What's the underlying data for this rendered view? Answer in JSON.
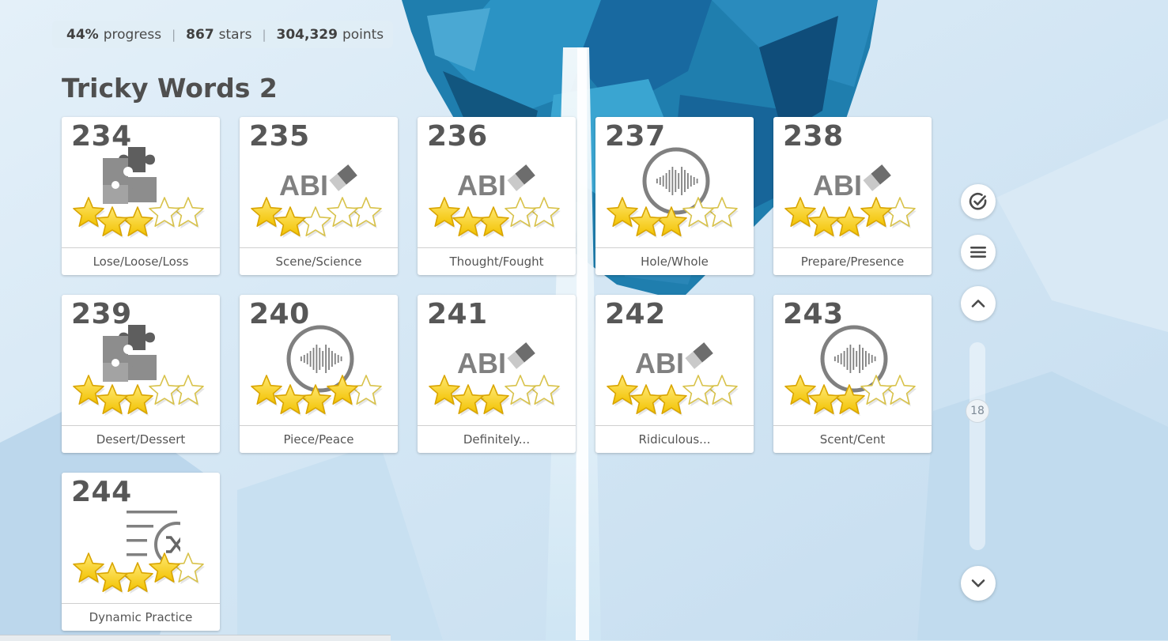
{
  "stats": {
    "progress_value": "44%",
    "progress_label": "progress",
    "stars_value": "867",
    "stars_label": "stars",
    "points_value": "304,329",
    "points_label": "points"
  },
  "section_title": "Tricky Words 2",
  "lessons": [
    {
      "number": "234",
      "label": "Lose/Loose/Loss",
      "icon": "puzzle-icon",
      "stars": 3
    },
    {
      "number": "235",
      "label": "Scene/Science",
      "icon": "spelling-icon",
      "stars": 2
    },
    {
      "number": "236",
      "label": "Thought/Fought",
      "icon": "spelling-icon",
      "stars": 3
    },
    {
      "number": "237",
      "label": "Hole/Whole",
      "icon": "audio-icon",
      "stars": 3
    },
    {
      "number": "238",
      "label": "Prepare/Presence",
      "icon": "spelling-icon",
      "stars": 4
    },
    {
      "number": "239",
      "label": "Desert/Dessert",
      "icon": "puzzle-icon",
      "stars": 3
    },
    {
      "number": "240",
      "label": "Piece/Peace",
      "icon": "audio-icon",
      "stars": 4
    },
    {
      "number": "241",
      "label": "Definitely...",
      "icon": "spelling-icon",
      "stars": 3
    },
    {
      "number": "242",
      "label": "Ridiculous...",
      "icon": "spelling-icon",
      "stars": 3
    },
    {
      "number": "243",
      "label": "Scent/Cent",
      "icon": "audio-icon",
      "stars": 3
    },
    {
      "number": "244",
      "label": "Dynamic Practice",
      "icon": "shuffle-icon",
      "stars": 4
    }
  ],
  "spelling_icon_text": "ABI",
  "scroll_position": "18",
  "colors": {
    "star_fill": "#f2c200",
    "star_light": "#ffe873",
    "star_stroke": "#d9a500",
    "icon_gray": "#808080",
    "background": "#d4e8f6",
    "ice_blue": "#1a78a8"
  }
}
